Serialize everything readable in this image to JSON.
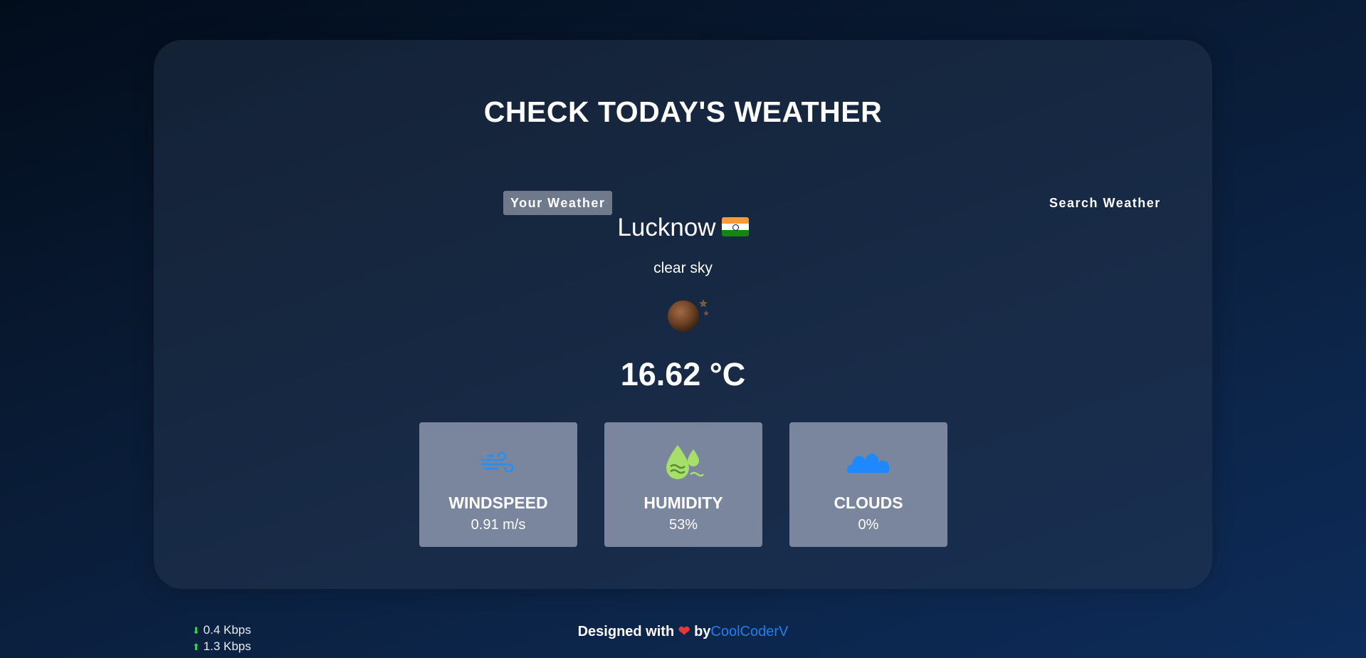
{
  "page": {
    "title": "CHECK TODAY'S WEATHER"
  },
  "tabs": [
    {
      "label": "Your Weather",
      "active": true
    },
    {
      "label": "Search Weather",
      "active": false
    }
  ],
  "weather": {
    "city": "Lucknow",
    "flag_icon": "india-flag",
    "description": "clear sky",
    "condition_icon": "clear-night-icon",
    "temperature": "16.62 °C"
  },
  "stats": [
    {
      "label": "WINDSPEED",
      "value": "0.91 m/s",
      "icon": "wind-icon",
      "color": "#2f8fe8"
    },
    {
      "label": "HUMIDITY",
      "value": "53%",
      "icon": "humidity-icon",
      "color": "#a6e06a"
    },
    {
      "label": "CLOUDS",
      "value": "0%",
      "icon": "clouds-icon",
      "color": "#1e88ff"
    }
  ],
  "footer": {
    "prefix": "Designed with",
    "heart": "❤",
    "by": "by",
    "author": "CoolCoderV"
  },
  "network": {
    "download": "0.4 Kbps",
    "upload": "1.3 Kbps"
  },
  "colors": {
    "card_bg": "#283750",
    "stat_bg": "#7a869d",
    "link": "#1e7ff0",
    "accent_green": "#3ccf4e"
  }
}
